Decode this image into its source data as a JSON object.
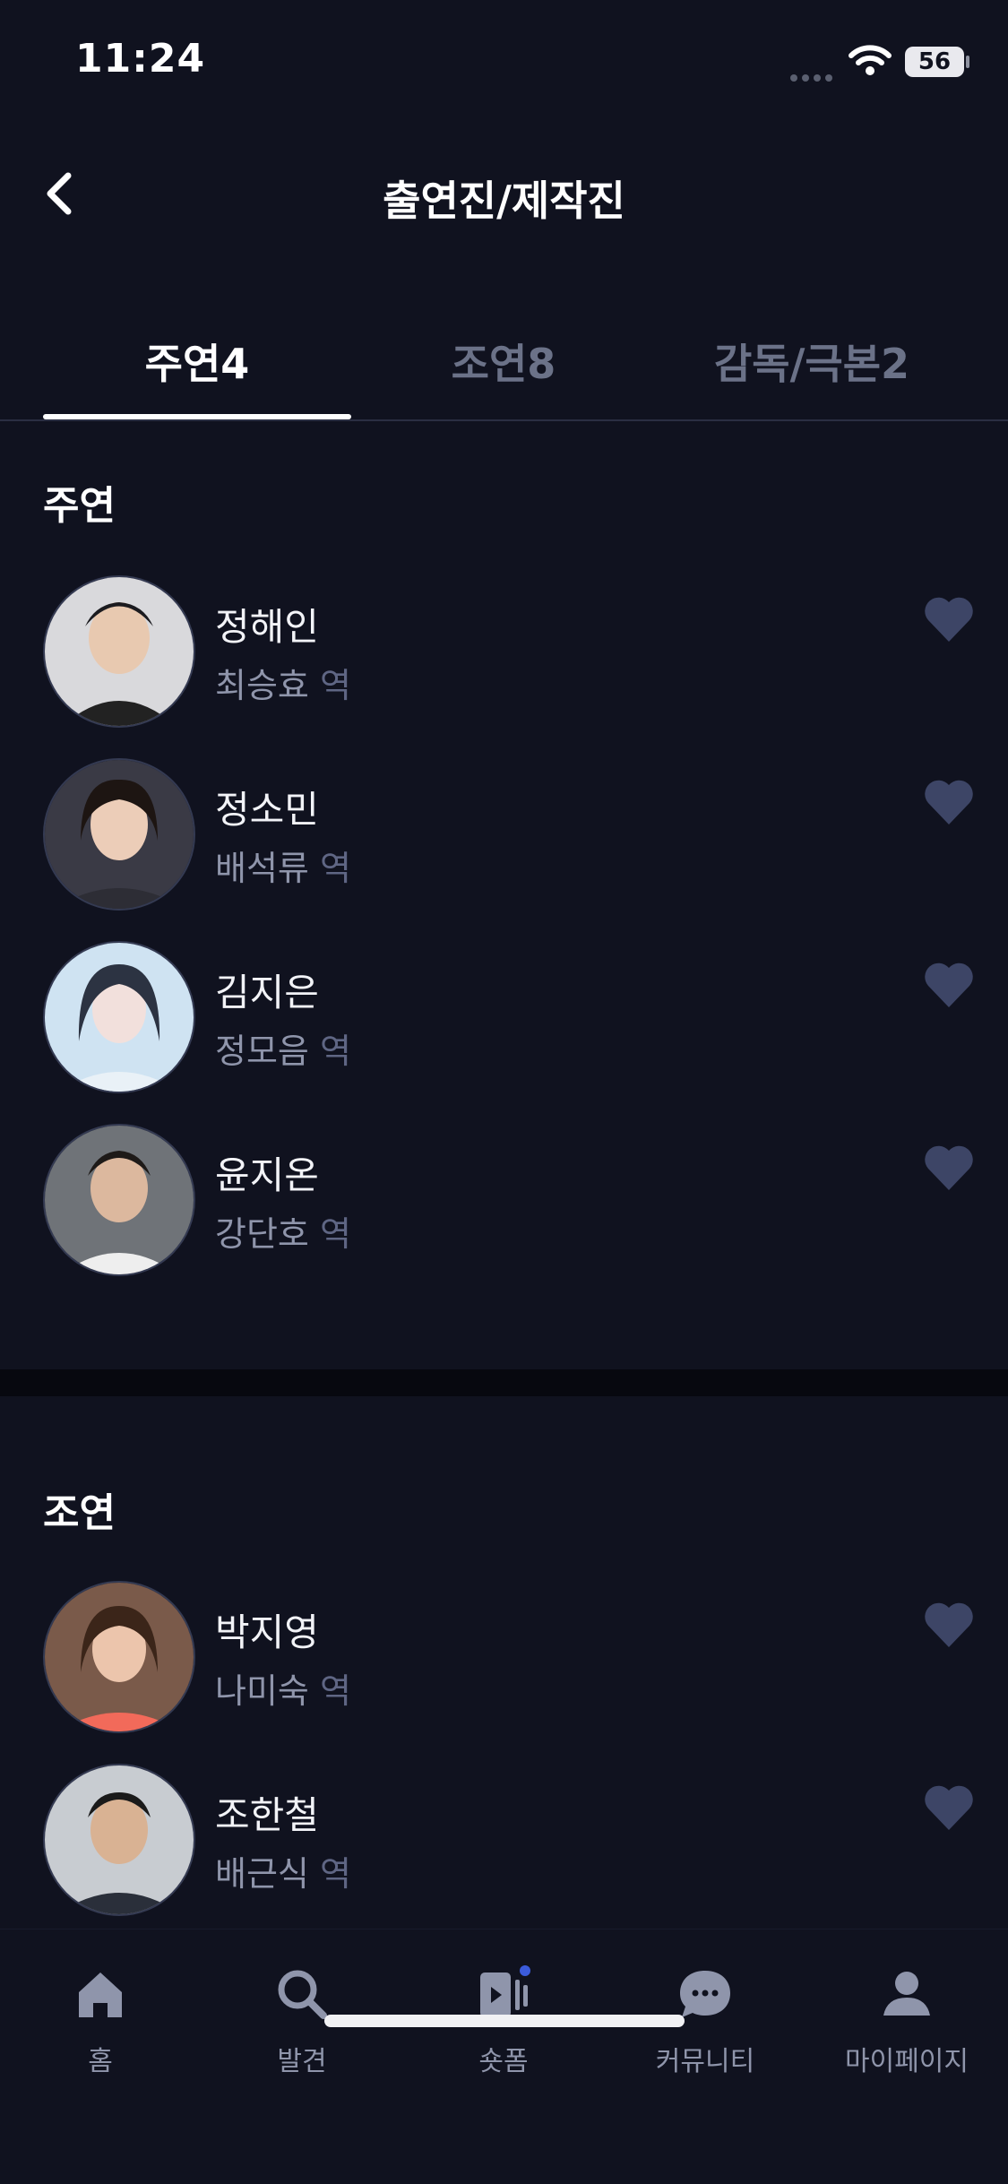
{
  "status": {
    "time": "11:24",
    "battery": "56"
  },
  "header": {
    "title": "출연진/제작진"
  },
  "tabs": [
    {
      "label": "주연4"
    },
    {
      "label": "조연8"
    },
    {
      "label": "감독/극본2"
    }
  ],
  "sections": {
    "lead": {
      "title": "주연",
      "people": [
        {
          "name": "정해인",
          "role": "최승효",
          "suffix": "역"
        },
        {
          "name": "정소민",
          "role": "배석류",
          "suffix": "역"
        },
        {
          "name": "김지은",
          "role": "정모음",
          "suffix": "역"
        },
        {
          "name": "윤지온",
          "role": "강단호",
          "suffix": "역"
        }
      ]
    },
    "support": {
      "title": "조연",
      "people": [
        {
          "name": "박지영",
          "role": "나미숙",
          "suffix": "역"
        },
        {
          "name": "조한철",
          "role": "배근식",
          "suffix": "역"
        }
      ]
    }
  },
  "bottom_nav": [
    {
      "label": "홈",
      "icon": "home-icon"
    },
    {
      "label": "발견",
      "icon": "search-icon"
    },
    {
      "label": "숏폼",
      "icon": "shortform-icon"
    },
    {
      "label": "커뮤니티",
      "icon": "chat-bubble-icon"
    },
    {
      "label": "마이페이지",
      "icon": "profile-icon"
    }
  ],
  "colors": {
    "background": "#10121f",
    "accent": "#3b5bdb",
    "muted": "#6b7288",
    "heart": "#3d4566"
  }
}
